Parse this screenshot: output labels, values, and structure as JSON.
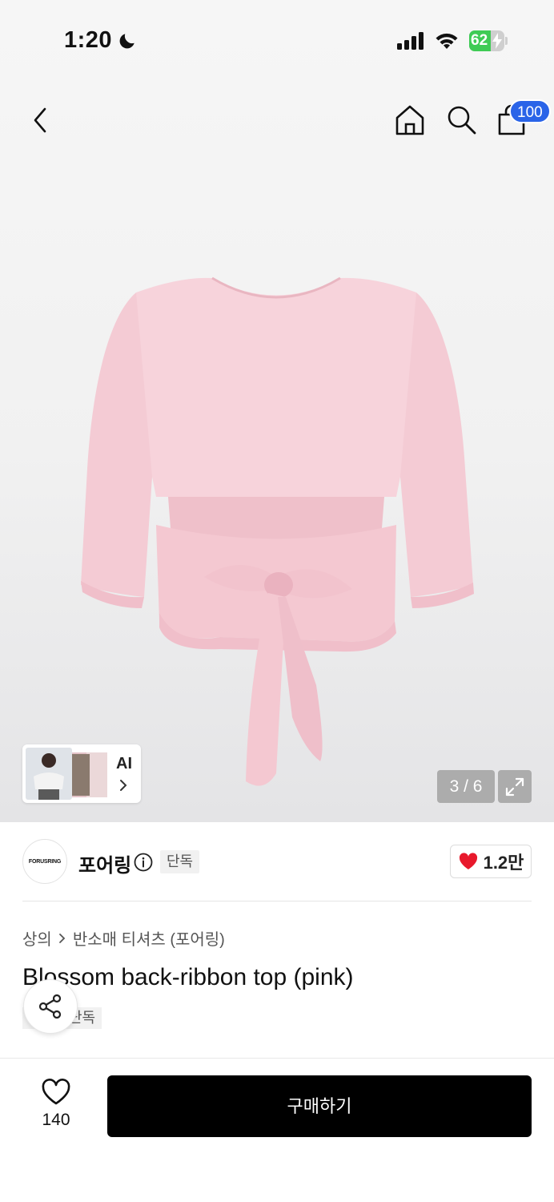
{
  "status_bar": {
    "time": "1:20",
    "battery": "62"
  },
  "nav": {
    "cart_count": "100"
  },
  "gallery": {
    "ai_label": "AI",
    "counter": "3 / 6"
  },
  "brand": {
    "logo_text": "FORUSRING",
    "name": "포어링",
    "tag": "단독",
    "likes": "1.2만"
  },
  "breadcrumb": {
    "level1": "상의",
    "level2": "반소매 티셔츠 (포어링)"
  },
  "product": {
    "title": "Blossom back-ribbon top (pink)",
    "tag": "단독"
  },
  "bottom": {
    "wish_count": "140",
    "buy_label": "구매하기"
  },
  "colors": {
    "accent_badge": "#2a64e8",
    "battery": "#3fcb55",
    "heart": "#e8192c",
    "buy_button": "#000000"
  }
}
